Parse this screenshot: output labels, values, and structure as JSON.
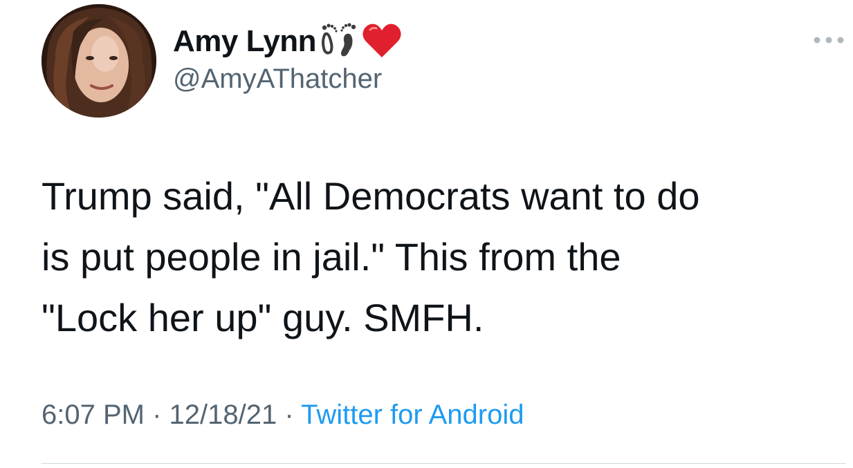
{
  "author": {
    "display_name": "Amy Lynn",
    "handle": "@AmyAThatcher",
    "name_emojis": [
      "footprints-icon",
      "red-heart-icon"
    ]
  },
  "tweet": {
    "text_lines": [
      "Trump said, \"All Democrats want to do",
      "is put people in jail.\" This from the",
      "\"Lock her up\" guy. SMFH."
    ],
    "time": "6:07 PM",
    "date": "12/18/21",
    "source": "Twitter for Android",
    "separator": "·"
  },
  "colors": {
    "text_primary": "#0f1419",
    "text_secondary": "#536471",
    "link_blue": "#1d9bf0",
    "heart_red": "#e0202e",
    "divider": "#cfd9de"
  },
  "icons": {
    "more": "more-options-icon"
  }
}
